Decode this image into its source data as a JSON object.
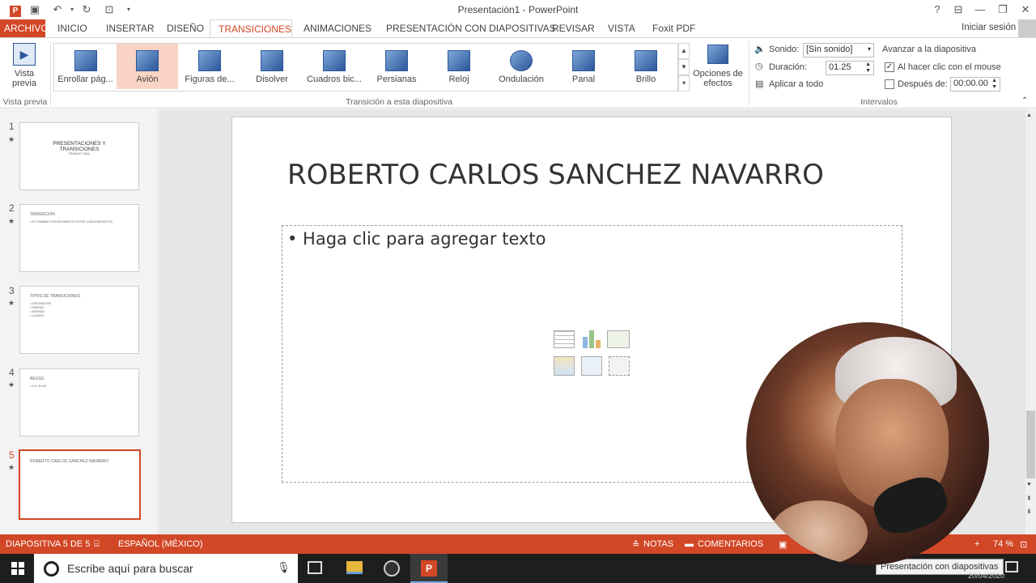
{
  "window": {
    "title": "Presentación1 - PowerPoint",
    "help": "?",
    "sign_in": "Iniciar sesión"
  },
  "tabs": [
    {
      "label": "ARCHIVO"
    },
    {
      "label": "INICIO"
    },
    {
      "label": "INSERTAR"
    },
    {
      "label": "DISEÑO"
    },
    {
      "label": "TRANSICIONES"
    },
    {
      "label": "ANIMACIONES"
    },
    {
      "label": "PRESENTACIÓN CON DIAPOSITIVAS"
    },
    {
      "label": "REVISAR"
    },
    {
      "label": "VISTA"
    },
    {
      "label": "Foxit PDF"
    }
  ],
  "ribbon": {
    "preview": {
      "label1": "Vista",
      "label2": "previa",
      "group": "Vista previa"
    },
    "transitions": [
      {
        "label": "Enrollar pág..."
      },
      {
        "label": "Avión"
      },
      {
        "label": "Figuras de..."
      },
      {
        "label": "Disolver"
      },
      {
        "label": "Cuadros bic..."
      },
      {
        "label": "Persianas"
      },
      {
        "label": "Reloj"
      },
      {
        "label": "Ondulación"
      },
      {
        "label": "Panal"
      },
      {
        "label": "Brillo"
      }
    ],
    "effects": {
      "label1": "Opciones de",
      "label2": "efectos"
    },
    "group_transition": "Transición a esta diapositiva",
    "sound_label": "Sonido:",
    "sound_value": "[Sin sonido]",
    "duration_label": "Duración:",
    "duration_value": "01.25",
    "apply_all": "Aplicar a todo",
    "advance_label": "Avanzar a la diapositiva",
    "on_click": "Al hacer clic con el mouse",
    "after_label": "Después de:",
    "after_value": "00:00.00",
    "group_timing": "Intervalos"
  },
  "slides": [
    {
      "num": "1",
      "title": "PRESENTACIONES Y TRANSICIONES",
      "sub": "TRABAJO FINAL"
    },
    {
      "num": "2",
      "title": "TRANSICION",
      "sub": "• ES CAMBIAR CON MOVIMIENTO ENTRE CADA DIAPOSITIVA"
    },
    {
      "num": "3",
      "title": "TIPOS DE TRANSICIONES",
      "sub": "• DESVANECER\n• RAPIDEZ\n• BARRIDO\n• CUADRO"
    },
    {
      "num": "4",
      "title": "BEGSU",
      "sub": "• S.A. SN SE"
    },
    {
      "num": "5",
      "title": "ROBERTO CARLOS SANCHEZ NAVARRO",
      "sub": ""
    }
  ],
  "slide": {
    "title": "ROBERTO CARLOS SANCHEZ NAVARRO",
    "placeholder": "• Haga clic para agregar texto"
  },
  "status": {
    "slide_info": "DIAPOSITIVA 5 DE 5",
    "language": "ESPAÑOL (MÉXICO)",
    "notes": "NOTAS",
    "comments": "COMENTARIOS",
    "zoom": "74 %"
  },
  "taskbar": {
    "search_placeholder": "Escribe aquí para buscar",
    "tooltip": "Presentación con diapositivas",
    "date": "20/04/2020"
  },
  "colors": {
    "accent": "#d24726",
    "selected_transition": "#f9d4c4"
  }
}
